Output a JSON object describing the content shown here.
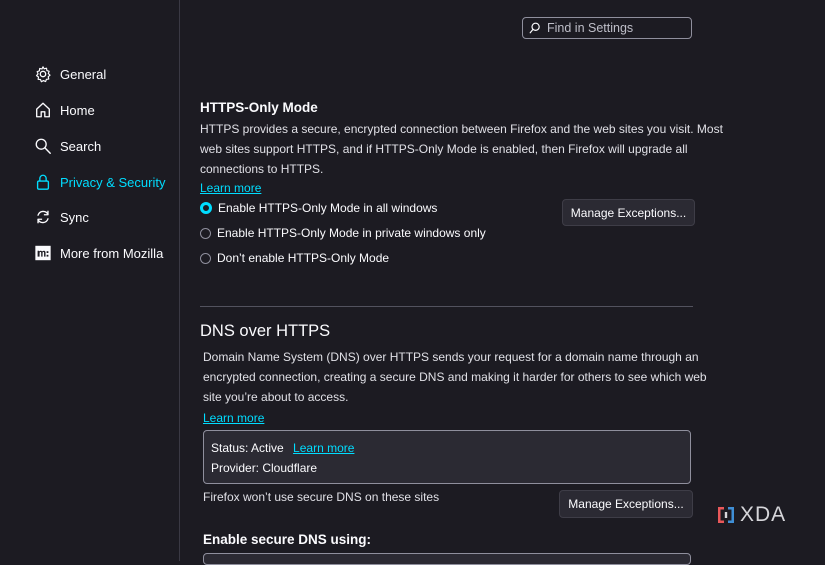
{
  "search": {
    "placeholder": "Find in Settings"
  },
  "sidebar": {
    "items": [
      {
        "label": "General",
        "icon": "gear-icon"
      },
      {
        "label": "Home",
        "icon": "home-icon"
      },
      {
        "label": "Search",
        "icon": "search-icon"
      },
      {
        "label": "Privacy & Security",
        "icon": "lock-icon",
        "active": true
      },
      {
        "label": "Sync",
        "icon": "sync-icon"
      },
      {
        "label": "More from Mozilla",
        "icon": "mozilla-icon"
      }
    ]
  },
  "https_only": {
    "title": "HTTPS-Only Mode",
    "description_1": "HTTPS provides a secure, encrypted connection between Firefox and the web sites you visit. Most",
    "description_2": "web sites support HTTPS, and if HTTPS-Only Mode is enabled, then Firefox will upgrade all",
    "description_3": "connections to HTTPS.",
    "learn_more": "Learn more",
    "options": [
      {
        "label": "Enable HTTPS-Only Mode in all windows",
        "checked": true
      },
      {
        "label": "Enable HTTPS-Only Mode in private windows only",
        "checked": false
      },
      {
        "label": "Don’t enable HTTPS-Only Mode",
        "checked": false
      }
    ],
    "manage_exceptions": "Manage Exceptions..."
  },
  "dns": {
    "title": "DNS over HTTPS",
    "description_1": "Domain Name System (DNS) over HTTPS sends your request for a domain name through an",
    "description_2": "encrypted connection, creating a secure DNS and making it harder for others to see which web",
    "description_3": "site you’re about to access.",
    "learn_more": "Learn more",
    "status": "Status: Active",
    "status_learn_more": "Learn more",
    "provider": "Provider: Cloudflare",
    "exceptions_note": "Firefox won’t use secure DNS on these sites",
    "manage_exceptions": "Manage Exceptions...",
    "enable_using": "Enable secure DNS using:"
  },
  "watermark": {
    "text": "XDA"
  },
  "colors": {
    "accent": "#00ddff",
    "background": "#1c1b22",
    "button": "#2b2a33"
  }
}
